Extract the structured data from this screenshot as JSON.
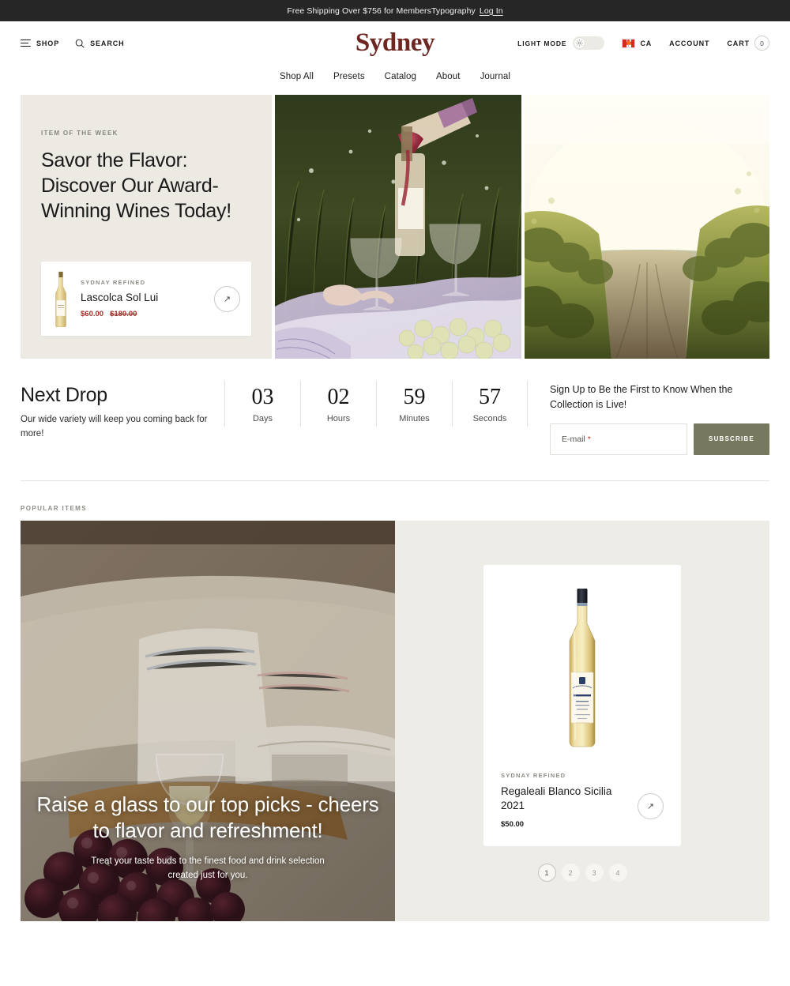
{
  "announcement": {
    "message": "Free Shipping Over $756 for MembersTypography",
    "login_label": "Log In"
  },
  "header": {
    "shop_label": "SHOP",
    "search_label": "SEARCH",
    "logo": "Sydney",
    "light_mode_label": "LIGHT MODE",
    "region_code": "CA",
    "account_label": "ACCOUNT",
    "cart_label": "CART",
    "cart_count": "0"
  },
  "nav": {
    "items": [
      {
        "label": "Shop All"
      },
      {
        "label": "Presets"
      },
      {
        "label": "Catalog"
      },
      {
        "label": "About"
      },
      {
        "label": "Journal"
      }
    ]
  },
  "hero": {
    "eyebrow": "ITEM OF THE WEEK",
    "title": "Savor the Flavor: Discover Our Award-Winning Wines Today!",
    "product": {
      "brand": "SYDNAY REFINED",
      "name": "Lascolca Sol Lui",
      "price": "$60.00",
      "compare_price": "$180.00",
      "arrow": "↗"
    }
  },
  "next_drop": {
    "title": "Next Drop",
    "subtitle": "Our wide variety will keep you coming back for more!",
    "timers": [
      {
        "value": "03",
        "label": "Days"
      },
      {
        "value": "02",
        "label": "Hours"
      },
      {
        "value": "59",
        "label": "Minutes"
      },
      {
        "value": "57",
        "label": "Seconds"
      }
    ],
    "signup": {
      "title": "Sign Up to Be the First to Know When the Collection is Live!",
      "email_label": "E-mail",
      "required_mark": "*",
      "subscribe_label": "SUBSCRIBE"
    }
  },
  "popular": {
    "section_label": "POPULAR ITEMS",
    "overlay_heading": "Raise a glass to our top picks - cheers to flavor and refreshment!",
    "overlay_sub": "Treat your taste buds to the finest food and drink selection created just for you.",
    "product": {
      "brand": "SYDNAY REFINED",
      "name": "Regaleali Blanco Sicilia 2021",
      "price": "$50.00",
      "bottle_label": "REGALEALI",
      "arrow": "↗"
    },
    "pagination": [
      {
        "label": "1"
      },
      {
        "label": "2"
      },
      {
        "label": "3"
      },
      {
        "label": "4"
      }
    ]
  },
  "colors": {
    "logo": "#6d2620",
    "sale_price": "#a03027",
    "subscribe_button": "#77795f",
    "panel_beige": "#eceae3",
    "announce_bg": "#262626"
  }
}
